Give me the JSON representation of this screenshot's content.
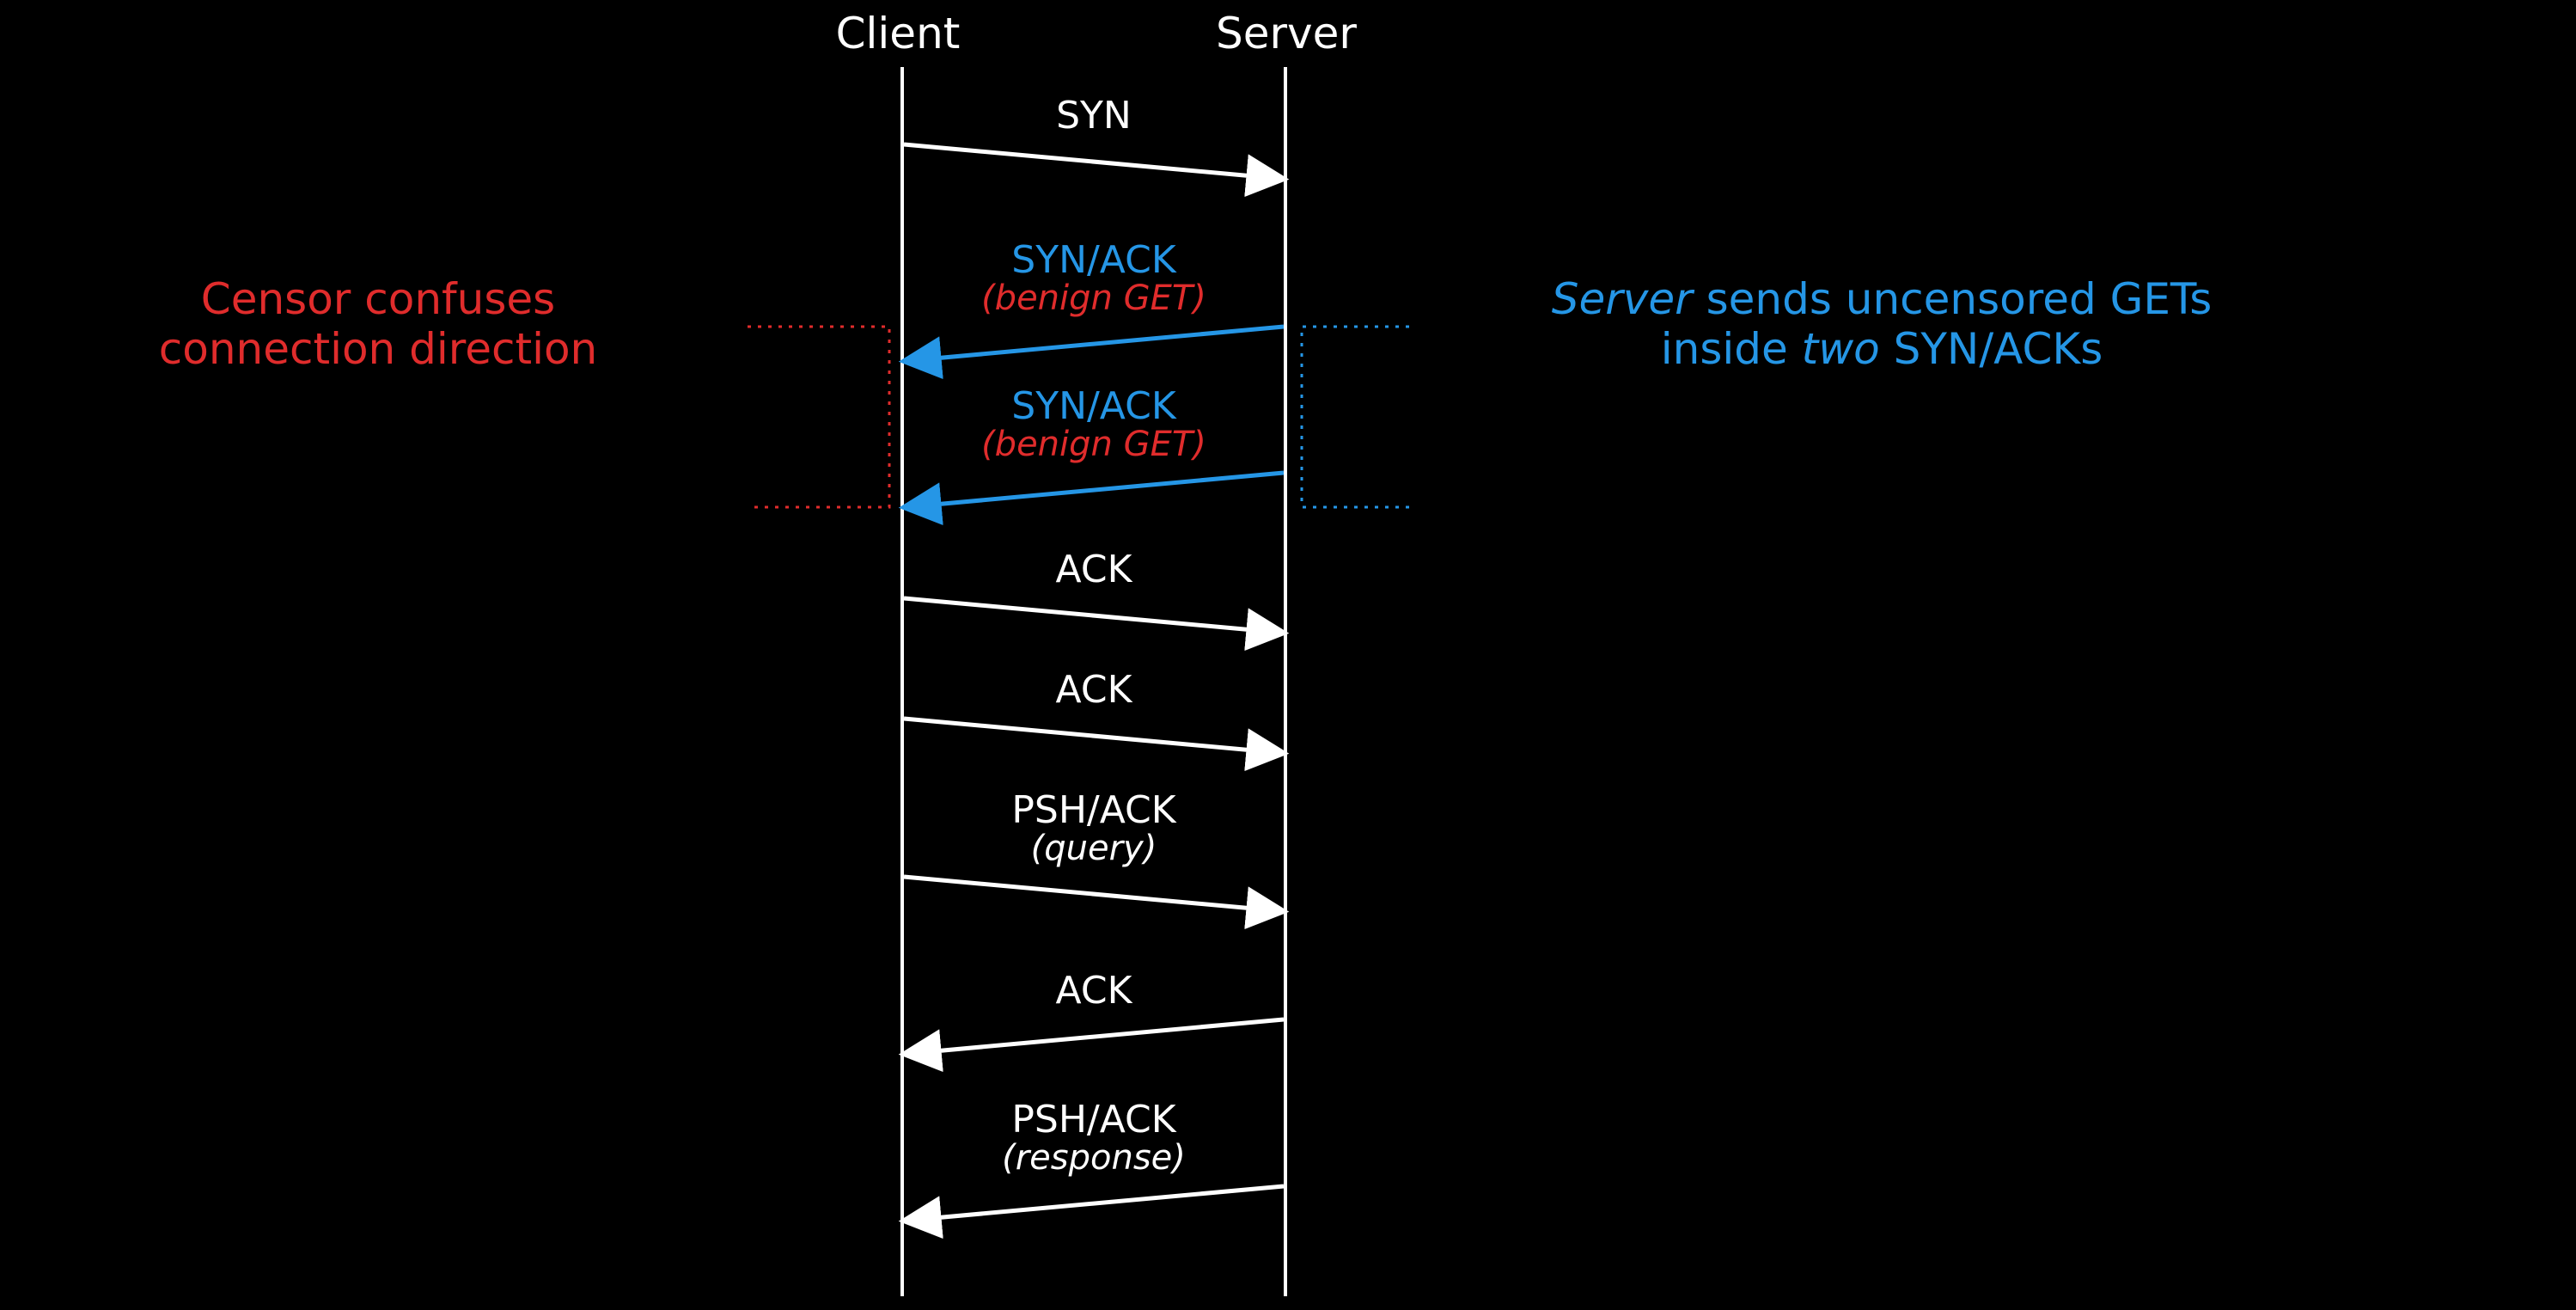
{
  "labels": {
    "client": "Client",
    "server": "Server"
  },
  "annotations": {
    "left_line1": "Censor confuses",
    "left_line2": "connection direction",
    "right_pre": "Server",
    "right_mid": " sends uncensored GETs",
    "right_line2a": "inside ",
    "right_line2b": "two",
    "right_line2c": " SYN/ACKs"
  },
  "messages": {
    "m1": {
      "label": "SYN"
    },
    "m2": {
      "label": "SYN/ACK",
      "sub": "(benign GET)"
    },
    "m3": {
      "label": "SYN/ACK",
      "sub": "(benign GET)"
    },
    "m4": {
      "label": "ACK"
    },
    "m5": {
      "label": "ACK"
    },
    "m6": {
      "label": "PSH/ACK",
      "sub": "(query)"
    },
    "m7": {
      "label": "ACK"
    },
    "m8": {
      "label": "PSH/ACK",
      "sub": "(response)"
    }
  },
  "chart_data": {
    "type": "sequence-diagram",
    "participants": [
      "Client",
      "Server"
    ],
    "messages": [
      {
        "from": "Client",
        "to": "Server",
        "label": "SYN",
        "color": "white"
      },
      {
        "from": "Server",
        "to": "Client",
        "label": "SYN/ACK",
        "payload": "benign GET",
        "color": "blue",
        "note": "uncensored GET inside SYN/ACK"
      },
      {
        "from": "Server",
        "to": "Client",
        "label": "SYN/ACK",
        "payload": "benign GET",
        "color": "blue",
        "note": "uncensored GET inside SYN/ACK"
      },
      {
        "from": "Client",
        "to": "Server",
        "label": "ACK",
        "color": "white"
      },
      {
        "from": "Client",
        "to": "Server",
        "label": "ACK",
        "color": "white"
      },
      {
        "from": "Client",
        "to": "Server",
        "label": "PSH/ACK",
        "payload": "query",
        "color": "white"
      },
      {
        "from": "Server",
        "to": "Client",
        "label": "ACK",
        "color": "white"
      },
      {
        "from": "Server",
        "to": "Client",
        "label": "PSH/ACK",
        "payload": "response",
        "color": "white"
      }
    ],
    "annotations": [
      {
        "side": "left",
        "text": "Censor confuses connection direction",
        "color": "#e02c2c",
        "spans_messages": [
          2,
          3
        ]
      },
      {
        "side": "right",
        "text": "Server sends uncensored GETs inside two SYN/ACKs",
        "color": "#2596e6",
        "spans_messages": [
          2,
          3
        ]
      }
    ]
  }
}
